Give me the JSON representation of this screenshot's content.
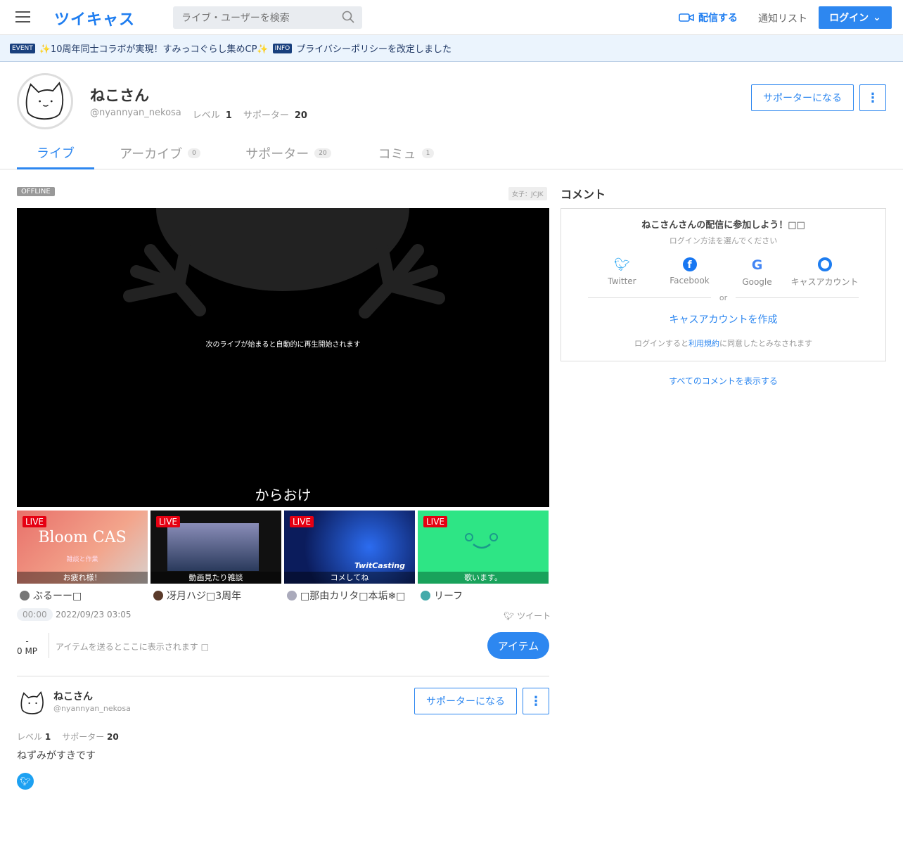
{
  "header": {
    "logo": "ツイキャス",
    "search_placeholder": "ライブ・ユーザーを検索",
    "broadcast": "配信する",
    "notifications": "通知リスト",
    "login": "ログイン"
  },
  "banner": [
    {
      "tag": "EVENT",
      "text": "✨10周年同士コラボが実現！すみっコぐらし集めCP✨"
    },
    {
      "tag": "INFO",
      "text": "プライバシーポリシーを改定しました"
    }
  ],
  "profile": {
    "name": "ねこさん",
    "handle": "@nyannyan_nekosa",
    "level_label": "レベル",
    "level": "1",
    "supporter_label": "サポーター",
    "supporters": "20",
    "support_button": "サポーターになる"
  },
  "tabs": [
    {
      "label": "ライブ"
    },
    {
      "label": "アーカイブ",
      "count": "0"
    },
    {
      "label": "サポーター",
      "count": "20"
    },
    {
      "label": "コミュ",
      "count": "1"
    }
  ],
  "live": {
    "status": "OFFLINE",
    "category": "女子：JCJK",
    "message": "次のライブが始まると自動的に再生開始されます",
    "title": "からおけ",
    "elapsed": "00:00",
    "date": "2022/09/23 03:05",
    "tweet": "ツイート",
    "mp_dash": "-",
    "mp": "0 MP",
    "item_placeholder": "アイテムを送るとここに表示されます □",
    "item_button": "アイテム"
  },
  "recommended": [
    {
      "badge": "LIVE",
      "caption": "お疲れ様！",
      "user": "ぶるーー□",
      "art": "Bloom CAS",
      "art_sub": "雑談と作業"
    },
    {
      "badge": "LIVE",
      "caption": "動画見たり雑談",
      "user": "冴月ハジ□3周年"
    },
    {
      "badge": "LIVE",
      "caption": "コメしてね",
      "user": "□那由カリタ□本垢❄□",
      "art": "TwitCasting"
    },
    {
      "badge": "LIVE",
      "caption": "歌います。",
      "user": "リーフ"
    }
  ],
  "comments": {
    "heading": "コメント",
    "join": "ねこさんさんの配信に参加しよう！□□",
    "choose": "ログイン方法を選んでください",
    "providers": [
      "Twitter",
      "Facebook",
      "Google",
      "キャスアカウント"
    ],
    "or": "or",
    "create": "キャスアカウントを作成",
    "terms_pre": "ログインすると",
    "terms_link": "利用規約",
    "terms_post": "に同意したとみなされます",
    "show_all": "すべてのコメントを表示する"
  },
  "bio": {
    "text": "ねずみがすきです"
  },
  "colors": {
    "accent": "#2d87f0",
    "live": "#e60012"
  }
}
